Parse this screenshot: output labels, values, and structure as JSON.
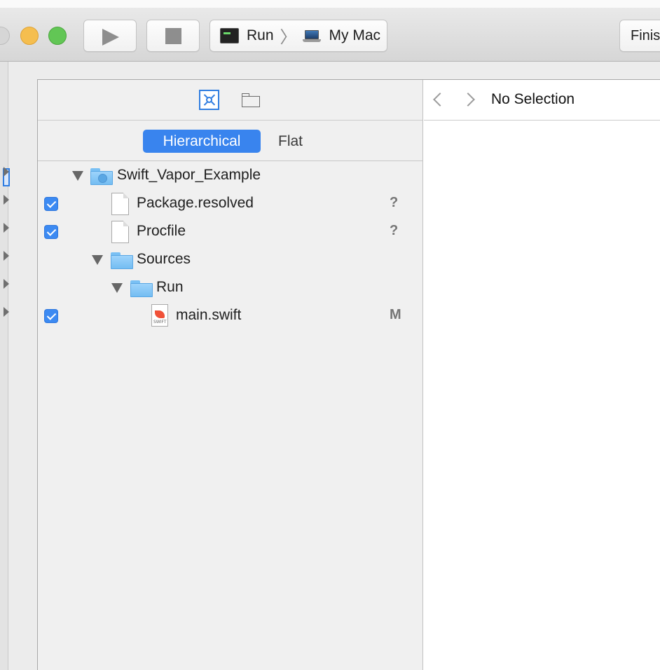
{
  "toolbar": {
    "scheme": {
      "target": "Run",
      "destination": "My Mac"
    },
    "status_label": "Finis"
  },
  "left_pane": {
    "segments": {
      "hierarchical": "Hierarchical",
      "flat": "Flat",
      "selected": "Hierarchical"
    },
    "tree": [
      {
        "label": "Swift_Vapor_Example",
        "kind": "project-folder",
        "checked": null,
        "status": ""
      },
      {
        "label": "Package.resolved",
        "kind": "file",
        "checked": true,
        "status": "?"
      },
      {
        "label": "Procfile",
        "kind": "file",
        "checked": true,
        "status": "?"
      },
      {
        "label": "Sources",
        "kind": "folder",
        "checked": null,
        "status": ""
      },
      {
        "label": "Run",
        "kind": "folder",
        "checked": null,
        "status": ""
      },
      {
        "label": "main.swift",
        "kind": "swift-file",
        "checked": true,
        "status": "M"
      }
    ]
  },
  "right_pane": {
    "title": "No Selection"
  },
  "icons": {
    "swift_badge": "SWIFT"
  },
  "colors": {
    "accent": "#3984ee",
    "folder": "#74bdf2",
    "minimize": "#f5be4f",
    "maximize": "#62c655"
  }
}
